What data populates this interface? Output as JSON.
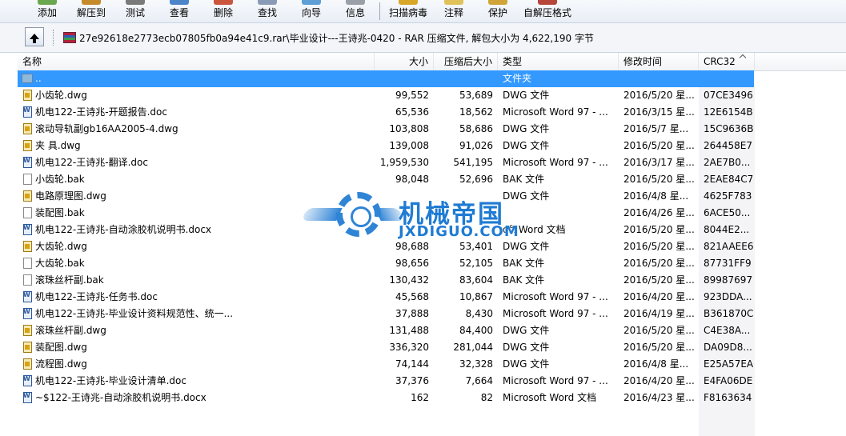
{
  "toolbar": {
    "buttons": [
      {
        "label": "添加",
        "icon": "add-icon"
      },
      {
        "label": "解压到",
        "icon": "extract-icon"
      },
      {
        "label": "测试",
        "icon": "test-icon"
      },
      {
        "label": "查看",
        "icon": "view-icon"
      },
      {
        "label": "删除",
        "icon": "delete-icon"
      },
      {
        "label": "查找",
        "icon": "find-icon"
      },
      {
        "label": "向导",
        "icon": "wizard-icon"
      },
      {
        "label": "信息",
        "icon": "info-icon"
      },
      {
        "label": "扫描病毒",
        "icon": "virus-scan-icon"
      },
      {
        "label": "注释",
        "icon": "comment-icon"
      },
      {
        "label": "保护",
        "icon": "protect-icon"
      },
      {
        "label": "自解压格式",
        "icon": "sfx-icon"
      }
    ]
  },
  "address": {
    "path": "27e92618e2773ecb07805fb0a94e41c9.rar\\毕业设计---王诗兆-0420 - RAR 压缩文件, 解包大小为 4,622,190 字节"
  },
  "columns": {
    "name": "名称",
    "size": "大小",
    "packed": "压缩后大小",
    "type": "类型",
    "modified": "修改时间",
    "crc": "CRC32"
  },
  "files": [
    {
      "name": "..",
      "size": "",
      "packed": "",
      "type": "文件夹",
      "modified": "",
      "crc": "",
      "icon": "folder-up",
      "selected": true
    },
    {
      "name": "小齿轮.dwg",
      "size": "99,552",
      "packed": "53,689",
      "type": "DWG 文件",
      "modified": "2016/5/20 星...",
      "crc": "07CE3496",
      "icon": "dwg"
    },
    {
      "name": "机电122-王诗兆-开题报告.doc",
      "size": "65,536",
      "packed": "18,562",
      "type": "Microsoft Word 97 - ...",
      "modified": "2016/3/15 星...",
      "crc": "12E6154B",
      "icon": "doc"
    },
    {
      "name": "滚动导轨副gb16AA2005-4.dwg",
      "size": "103,808",
      "packed": "58,686",
      "type": "DWG 文件",
      "modified": "2016/5/7 星...",
      "crc": "15C9636B",
      "icon": "dwg"
    },
    {
      "name": "夹 具.dwg",
      "size": "139,008",
      "packed": "91,026",
      "type": "DWG 文件",
      "modified": "2016/5/20 星...",
      "crc": "264458E7",
      "icon": "dwg"
    },
    {
      "name": "机电122-王诗兆-翻译.doc",
      "size": "1,959,530",
      "packed": "541,195",
      "type": "Microsoft Word 97 - ...",
      "modified": "2016/3/17 星...",
      "crc": "2AE7B0...",
      "icon": "doc"
    },
    {
      "name": "小齿轮.bak",
      "size": "98,048",
      "packed": "52,696",
      "type": "BAK 文件",
      "modified": "2016/5/20 星...",
      "crc": "2EAE84C7",
      "icon": "bak"
    },
    {
      "name": "电路原理图.dwg",
      "size": "",
      "packed": "",
      "type": "DWG 文件",
      "modified": "2016/4/8 星...",
      "crc": "4625F783",
      "icon": "dwg"
    },
    {
      "name": "装配图.bak",
      "size": "",
      "packed": "",
      "type": "",
      "modified": "2016/4/26 星...",
      "crc": "6ACE50...",
      "icon": "bak"
    },
    {
      "name": "机电122-王诗兆-自动涂胶机说明书.docx",
      "size": "",
      "packed": "",
      "type": "oft Word 文档",
      "modified": "2016/5/20 星...",
      "crc": "8044E2...",
      "icon": "doc"
    },
    {
      "name": "大齿轮.dwg",
      "size": "98,688",
      "packed": "53,401",
      "type": "DWG 文件",
      "modified": "2016/5/20 星...",
      "crc": "821AAEE6",
      "icon": "dwg"
    },
    {
      "name": "大齿轮.bak",
      "size": "98,656",
      "packed": "52,105",
      "type": "BAK 文件",
      "modified": "2016/5/20 星...",
      "crc": "87731FF9",
      "icon": "bak"
    },
    {
      "name": "滚珠丝杆副.bak",
      "size": "130,432",
      "packed": "83,604",
      "type": "BAK 文件",
      "modified": "2016/5/20 星...",
      "crc": "89987697",
      "icon": "bak"
    },
    {
      "name": "机电122-王诗兆-任务书.doc",
      "size": "45,568",
      "packed": "10,867",
      "type": "Microsoft Word 97 - ...",
      "modified": "2016/4/20 星...",
      "crc": "923DDA...",
      "icon": "doc"
    },
    {
      "name": "机电122-王诗兆-毕业设计资料规范性、统一...",
      "size": "37,888",
      "packed": "8,430",
      "type": "Microsoft Word 97 - ...",
      "modified": "2016/4/19 星...",
      "crc": "B361870C",
      "icon": "doc"
    },
    {
      "name": "滚珠丝杆副.dwg",
      "size": "131,488",
      "packed": "84,400",
      "type": "DWG 文件",
      "modified": "2016/5/20 星...",
      "crc": "C4E38A...",
      "icon": "dwg"
    },
    {
      "name": "装配图.dwg",
      "size": "336,320",
      "packed": "281,044",
      "type": "DWG 文件",
      "modified": "2016/5/20 星...",
      "crc": "DA09D8...",
      "icon": "dwg"
    },
    {
      "name": "流程图.dwg",
      "size": "74,144",
      "packed": "32,328",
      "type": "DWG 文件",
      "modified": "2016/4/8 星...",
      "crc": "E25A57EA",
      "icon": "dwg"
    },
    {
      "name": "机电122-王诗兆-毕业设计清单.doc",
      "size": "37,376",
      "packed": "7,664",
      "type": "Microsoft Word 97 - ...",
      "modified": "2016/4/20 星...",
      "crc": "E4FA06DE",
      "icon": "doc"
    },
    {
      "name": "~$122-王诗兆-自动涂胶机说明书.docx",
      "size": "162",
      "packed": "82",
      "type": "Microsoft Word 文档",
      "modified": "2016/4/23 星...",
      "crc": "F8163634",
      "icon": "doc"
    }
  ],
  "watermark": {
    "title": "机械帝国",
    "url": "JXDIGUO.COM"
  },
  "colors": {
    "selection": "#3399ff",
    "watermark": "#1f7bd3"
  }
}
